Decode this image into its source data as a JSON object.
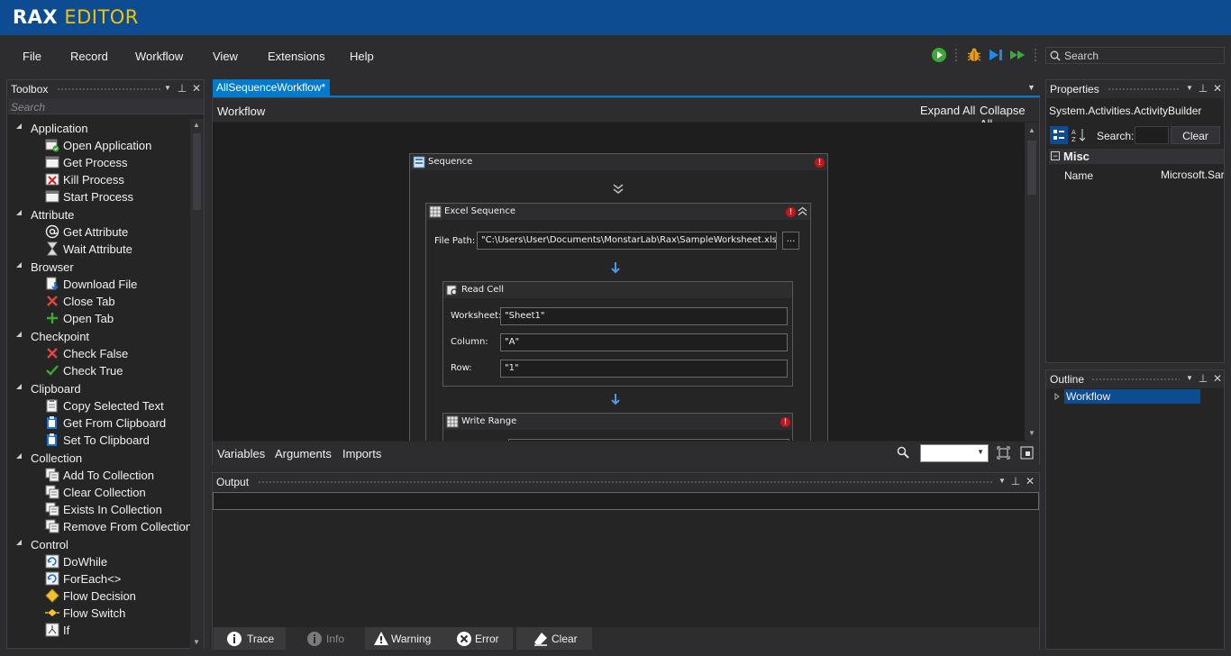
{
  "app": {
    "logo_part1": "RAX",
    "logo_part2": "EDITOR"
  },
  "menu": {
    "items": [
      "File",
      "Record",
      "Workflow",
      "View",
      "Extensions",
      "Help"
    ]
  },
  "toolbar": {
    "icons": [
      "play-icon",
      "debug-icon",
      "step-icon",
      "run-fast-icon"
    ],
    "search_placeholder": "Search"
  },
  "toolbox": {
    "title": "Toolbox",
    "search_placeholder": "Search",
    "categories": [
      {
        "label": "Application",
        "items": [
          {
            "label": "Open Application",
            "icon": "open-application-icon"
          },
          {
            "label": "Get Process",
            "icon": "window-icon"
          },
          {
            "label": "Kill Process",
            "icon": "kill-icon"
          },
          {
            "label": "Start Process",
            "icon": "window-icon"
          }
        ]
      },
      {
        "label": "Attribute",
        "items": [
          {
            "label": "Get Attribute",
            "icon": "at-icon"
          },
          {
            "label": "Wait Attribute",
            "icon": "hourglass-icon"
          }
        ]
      },
      {
        "label": "Browser",
        "items": [
          {
            "label": "Download File",
            "icon": "download-icon"
          },
          {
            "label": "Close Tab",
            "icon": "close-x-icon"
          },
          {
            "label": "Open Tab",
            "icon": "plus-icon"
          }
        ]
      },
      {
        "label": "Checkpoint",
        "items": [
          {
            "label": "Check False",
            "icon": "close-x-icon"
          },
          {
            "label": "Check True",
            "icon": "check-icon"
          }
        ]
      },
      {
        "label": "Clipboard",
        "items": [
          {
            "label": "Copy Selected Text",
            "icon": "clipboard-icon"
          },
          {
            "label": "Get From Clipboard",
            "icon": "clipboard-blue-icon"
          },
          {
            "label": "Set To Clipboard",
            "icon": "clipboard-blue-icon"
          }
        ]
      },
      {
        "label": "Collection",
        "items": [
          {
            "label": "Add To Collection",
            "icon": "collection-icon"
          },
          {
            "label": "Clear Collection",
            "icon": "collection-icon"
          },
          {
            "label": "Exists In Collection",
            "icon": "collection-icon"
          },
          {
            "label": "Remove From Collection",
            "icon": "collection-icon"
          }
        ]
      },
      {
        "label": "Control",
        "items": [
          {
            "label": "DoWhile",
            "icon": "loop-icon"
          },
          {
            "label": "ForEach<>",
            "icon": "loop-icon"
          },
          {
            "label": "Flow Decision",
            "icon": "diamond-icon"
          },
          {
            "label": "Flow Switch",
            "icon": "switch-icon"
          },
          {
            "label": "If",
            "icon": "if-icon"
          }
        ]
      }
    ]
  },
  "document": {
    "tab_label": "AllSequenceWorkflow*"
  },
  "designer": {
    "breadcrumb": "Workflow",
    "expand_all": "Expand All",
    "collapse_all": "Collapse All",
    "sequence_title": "Sequence",
    "excel_title": "Excel Sequence",
    "file_path_label": "File Path:",
    "file_path_value": "\"C:\\Users\\User\\Documents\\MonstarLab\\Rax\\SampleWorksheet.xlsx\"",
    "browse_label": "...",
    "read_cell_title": "Read Cell",
    "worksheet_label": "Worksheet:",
    "worksheet_value": "\"Sheet1\"",
    "column_label": "Column:",
    "column_value": "\"A\"",
    "row_label": "Row:",
    "row_value": "\"1\"",
    "write_range_title": "Write Range",
    "footer_tabs": [
      "Variables",
      "Arguments",
      "Imports"
    ]
  },
  "output": {
    "title": "Output",
    "tabs": [
      {
        "label": "Trace",
        "icon": "info-icon"
      },
      {
        "label": "Info",
        "icon": "info-icon"
      },
      {
        "label": "Warning",
        "icon": "warning-icon"
      },
      {
        "label": "Error",
        "icon": "error-icon"
      },
      {
        "label": "Clear",
        "icon": "eraser-icon"
      }
    ]
  },
  "properties": {
    "title": "Properties",
    "type_name": "System.Activities.ActivityBuilder",
    "search_label": "Search:",
    "clear_label": "Clear",
    "category": "Misc",
    "row_name": "Name",
    "row_value": "Microsoft.Sar"
  },
  "outline": {
    "title": "Outline",
    "item": "Workflow"
  },
  "colors": {
    "titlebar": "#0e4c92",
    "accent": "#007acc",
    "logo_accent": "#f3c400",
    "error": "#c5151a"
  }
}
